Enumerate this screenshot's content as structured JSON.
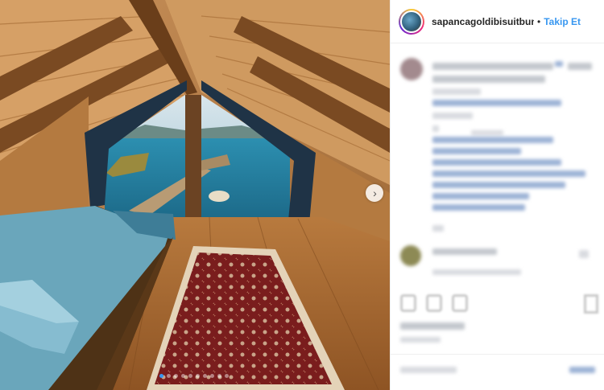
{
  "post": {
    "username": "sapancagoldibisuitbungalov",
    "separator": "•",
    "follow_label": "Takip Et",
    "carousel_total": 10,
    "carousel_active": 1
  },
  "icons": {
    "next": "chevron-right-icon",
    "like": "heart-icon",
    "comment": "comment-icon",
    "share": "share-icon",
    "save": "bookmark-icon"
  },
  "colors": {
    "accent": "#3897f0",
    "border": "#efefef",
    "text": "#262626"
  }
}
